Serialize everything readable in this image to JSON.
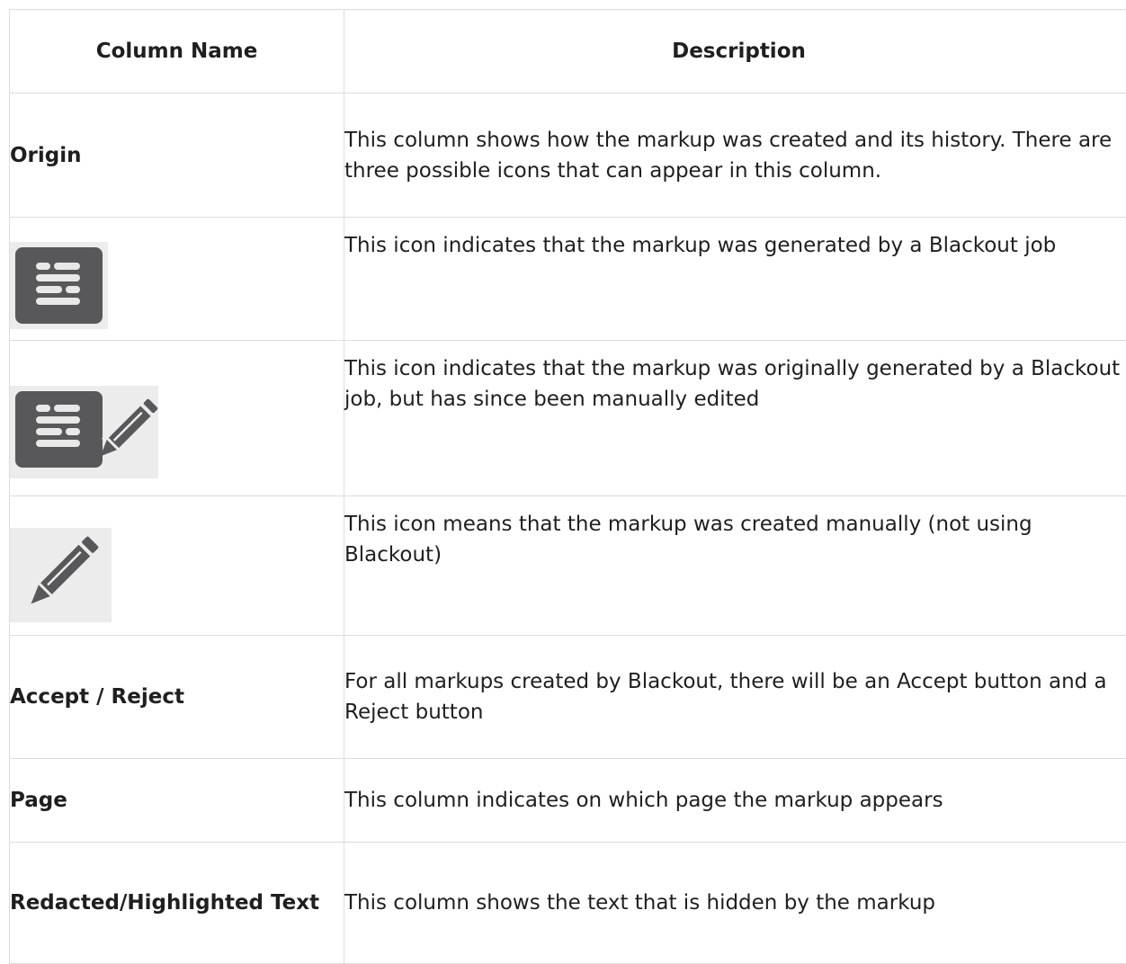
{
  "table": {
    "headers": {
      "name": "Column Name",
      "description": "Description"
    },
    "rows": [
      {
        "name": "Origin",
        "description": "This column shows how the markup was created and its history. There are three possible icons that can appear in this column."
      },
      {
        "icon": "blackout-icon",
        "description": "This icon indicates that the markup was generated by a Blackout job"
      },
      {
        "icon": "blackout-edited-icon",
        "description": "This icon indicates that the markup was originally generated by a Blackout job, but has since been manually edited"
      },
      {
        "icon": "pencil-icon",
        "description": "This icon means that the markup was created manually (not using Blackout)"
      },
      {
        "name": "Accept / Reject",
        "description": "For all markups created by Blackout, there will be an Accept button and a Reject button"
      },
      {
        "name": "Page",
        "description": "This column indicates on which page the markup appears"
      },
      {
        "name": "Redacted/Highlighted Text",
        "description": "This column shows the text that is hidden by the markup"
      }
    ]
  },
  "colors": {
    "icon_fill": "#58585a",
    "icon_background": "#ececec",
    "border": "#dcdcdc"
  }
}
